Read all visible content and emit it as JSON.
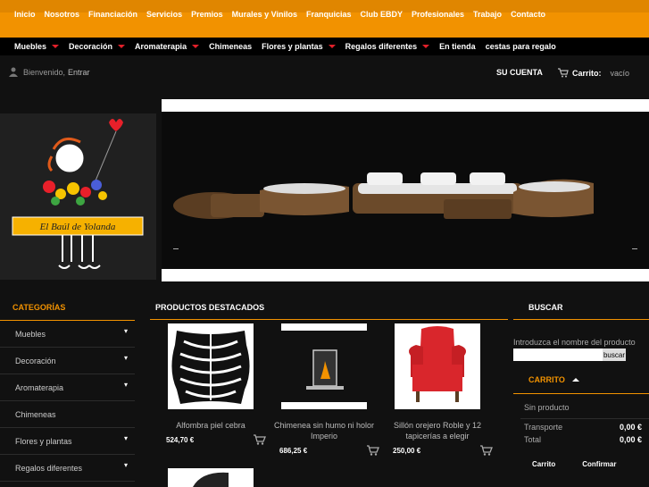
{
  "top_nav": [
    "Inicio",
    "Nosotros",
    "Financiación",
    "Servicios",
    "Premios",
    "Murales y Vinilos",
    "Franquicias",
    "Club EBDY",
    "Profesionales",
    "Trabajo",
    "Contacto"
  ],
  "cat_nav": [
    {
      "label": "Muebles",
      "has_menu": true
    },
    {
      "label": "Decoración",
      "has_menu": true
    },
    {
      "label": "Aromaterapia",
      "has_menu": true
    },
    {
      "label": "Chimeneas",
      "has_menu": false
    },
    {
      "label": "Flores y plantas",
      "has_menu": true
    },
    {
      "label": "Regalos diferentes",
      "has_menu": true
    },
    {
      "label": "En tienda",
      "has_menu": false
    },
    {
      "label": "cestas para regalo",
      "has_menu": false
    }
  ],
  "user": {
    "welcome": "Bienvenido,",
    "login": "Entrar",
    "account": "SU CUENTA",
    "cart_label": "Carrito:",
    "cart_status": "vacío"
  },
  "logo": {
    "text": "El Baúl de Yolanda"
  },
  "categories": {
    "title": "CATEGORÍAS",
    "items": [
      {
        "label": "Muebles",
        "expand": true
      },
      {
        "label": "Decoración",
        "expand": true
      },
      {
        "label": "Aromaterapia",
        "expand": true
      },
      {
        "label": "Chimeneas",
        "expand": false
      },
      {
        "label": "Flores y plantas",
        "expand": true
      },
      {
        "label": "Regalos diferentes",
        "expand": true
      }
    ]
  },
  "featured": {
    "title": "PRODUCTOS DESTACADOS",
    "products": [
      {
        "name": "Alfombra piel cebra",
        "price": "524,70 €"
      },
      {
        "name": "Chimenea sin humo ni holor Imperio",
        "price": "686,25 €"
      },
      {
        "name": "Sillón orejero Roble y 12 tapicerías a elegir",
        "price": "250,00 €"
      }
    ]
  },
  "search": {
    "title": "BUSCAR",
    "hint": "Introduzca el nombre del producto",
    "placeholder": "",
    "button": "buscar"
  },
  "cart": {
    "title": "CARRITO",
    "empty": "Sin producto",
    "rows": [
      {
        "label": "Transporte",
        "value": "0,00 €"
      },
      {
        "label": "Total",
        "value": "0,00 €"
      }
    ],
    "buttons": [
      "Carrito",
      "Confirmar"
    ]
  },
  "colors": {
    "accent": "#f29200",
    "bar": "#e08600",
    "caret": "#e2202a",
    "chair": "#d9262c"
  }
}
